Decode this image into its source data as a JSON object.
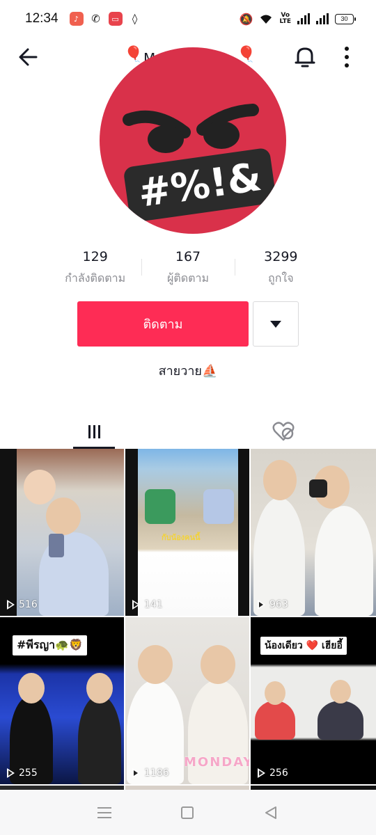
{
  "status_bar": {
    "time": "12:34",
    "battery": "30",
    "network": "VoLTE"
  },
  "header": {
    "name_partial": "M",
    "balloon_icon": "🎈"
  },
  "avatar": {
    "text": "#%!&"
  },
  "stats": [
    {
      "value": "129",
      "label": "กำลังติดตาม"
    },
    {
      "value": "167",
      "label": "ผู้ติดตาม"
    },
    {
      "value": "3299",
      "label": "ถูกใจ"
    }
  ],
  "actions": {
    "follow_label": "ติดตาม"
  },
  "bio": "สายวาย⛵",
  "videos": [
    {
      "views": "516"
    },
    {
      "views": "141",
      "caption": "กับน้องคนนี้"
    },
    {
      "views": "963"
    },
    {
      "views": "255",
      "caption": "#พีรญา🐢🦁"
    },
    {
      "views": "1186",
      "caption": "MONDAY"
    },
    {
      "views": "256",
      "caption": "น้องเดียว ❤️ เฮียอี้"
    }
  ],
  "colors": {
    "accent": "#fe2c55",
    "text": "#161823",
    "muted": "#8a8b91"
  }
}
